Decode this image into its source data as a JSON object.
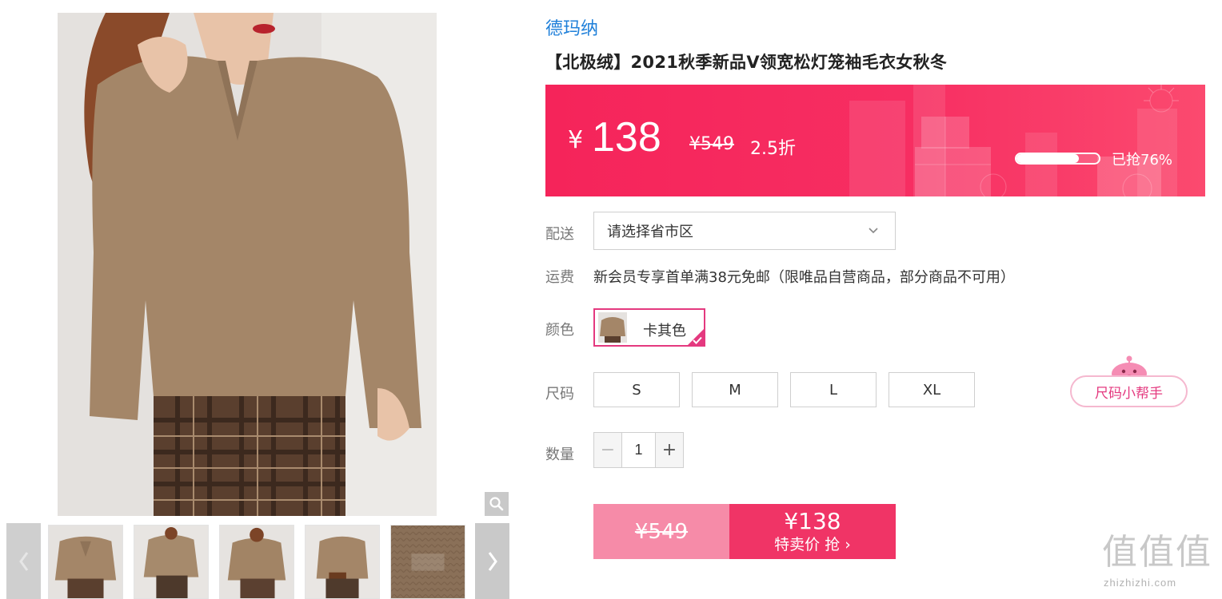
{
  "product": {
    "brand": "德玛纳",
    "title": "【北极绒】2021秋季新品V领宽松灯笼袖毛衣女秋冬"
  },
  "price_banner": {
    "currency": "¥",
    "price": "138",
    "original_price": "¥549",
    "discount": "2.5折",
    "sold_progress": 0.76,
    "sold_text": "已抢76%"
  },
  "delivery": {
    "label": "配送",
    "region_placeholder": "请选择省市区"
  },
  "shipping": {
    "label": "运费",
    "text": "新会员专享首单满38元免邮（限唯品自营商品，部分商品不可用）"
  },
  "color": {
    "label": "颜色",
    "selected": "卡其色"
  },
  "size": {
    "label": "尺码",
    "options": [
      "S",
      "M",
      "L",
      "XL"
    ],
    "helper_label": "尺码小帮手"
  },
  "quantity": {
    "label": "数量",
    "value": "1",
    "minus": "−",
    "plus": "+"
  },
  "buy_bar": {
    "original_price": "¥549",
    "price": "¥138",
    "action": "特卖价 抢 ›"
  },
  "gallery": {
    "thumb_count": 5,
    "prev_icon": "‹",
    "next_icon": "›"
  },
  "watermark": {
    "logo": "值值值",
    "url": "zhizhizhi.com"
  },
  "colors": {
    "brand_blue": "#1e7fd9",
    "accent_pink": "#f03466",
    "selected_border": "#e4397f"
  }
}
